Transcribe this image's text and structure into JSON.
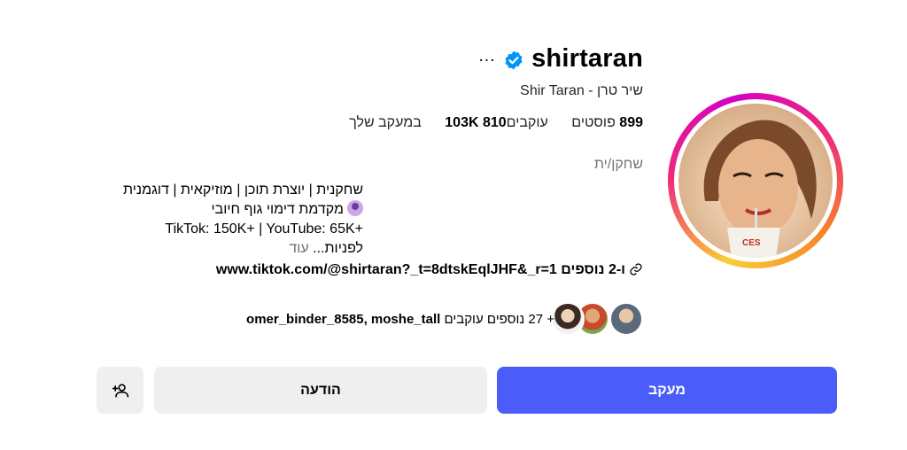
{
  "profile": {
    "username": "shirtaran",
    "full_name": "שיר טרן - Shir Taran",
    "verified_color": "#0095f6",
    "more_label": "…"
  },
  "stats": {
    "posts_count": "899",
    "posts_label": "פוסטים",
    "followers_count": "103K",
    "followers_label": "עוקבים",
    "following_count": "810",
    "following_label": "במעקב שלך"
  },
  "category": "שחקן/ית",
  "bio": {
    "line1": "שחקנית | יוצרת תוכן | מוזיקאית | דוגמנית",
    "line2": "מקדמת דימוי גוף חיובי",
    "line2_icon": "woman-emoji-icon",
    "line3": "TikTok: 150K+ | YouTube: 65K+",
    "line4_text": "לפניות...",
    "line4_more": "עוד"
  },
  "link": {
    "url": "www.tiktok.com/@shirtaran?_t=8dtskEqlJHF&_r=1",
    "extra": "ו-2 נוספים",
    "icon": "link-icon"
  },
  "followed_by": {
    "names": "omer_binder_8585, moshe_tall",
    "suffix": "+ 27 נוספים עוקבים"
  },
  "buttons": {
    "follow": "מעקב",
    "message": "הודעה",
    "add_icon": "add-person-icon"
  },
  "colors": {
    "follow_button": "#4a5df9",
    "secondary_button": "#efefef",
    "muted_text": "#737373"
  }
}
